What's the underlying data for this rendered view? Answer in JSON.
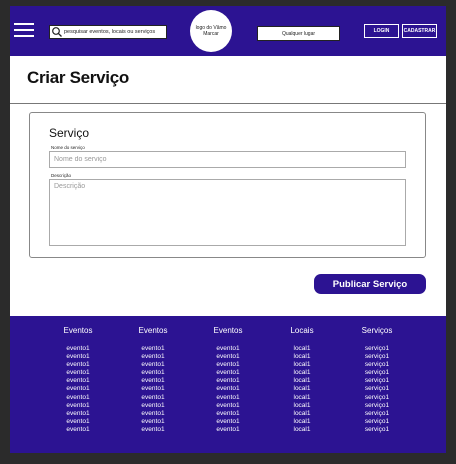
{
  "header": {
    "search_placeholder": "pesquisar eventos, locais ou serviços",
    "logo_text": "logo do Vâmo Marcar",
    "location_label": "Qualquer lugar",
    "login_label": "LOGIN",
    "cadastrar_label": "CADASTRAR"
  },
  "page": {
    "title": "Criar Serviço"
  },
  "form": {
    "section_title": "Serviço",
    "name_label": "Nome do serviço",
    "name_placeholder": "Nome do serviço",
    "description_label": "Descrição",
    "description_placeholder": "Descrição",
    "submit_label": "Publicar Serviço"
  },
  "footer": {
    "columns": [
      {
        "title": "Eventos",
        "items": [
          "evento1",
          "evento1",
          "evento1",
          "evento1",
          "evento1",
          "evento1",
          "evento1",
          "evento1",
          "evento1",
          "evento1",
          "evento1"
        ]
      },
      {
        "title": "Eventos",
        "items": [
          "evento1",
          "evento1",
          "evento1",
          "evento1",
          "evento1",
          "evento1",
          "evento1",
          "evento1",
          "evento1",
          "evento1",
          "evento1"
        ]
      },
      {
        "title": "Eventos",
        "items": [
          "evento1",
          "evento1",
          "evento1",
          "evento1",
          "evento1",
          "evento1",
          "evento1",
          "evento1",
          "evento1",
          "evento1",
          "evento1"
        ]
      },
      {
        "title": "Locais",
        "items": [
          "local1",
          "local1",
          "local1",
          "local1",
          "local1",
          "local1",
          "local1",
          "local1",
          "local1",
          "local1",
          "local1"
        ]
      },
      {
        "title": "Serviços",
        "items": [
          "serviço1",
          "serviço1",
          "serviço1",
          "serviço1",
          "serviço1",
          "serviço1",
          "serviço1",
          "serviço1",
          "serviço1",
          "serviço1",
          "serviço1"
        ]
      }
    ]
  },
  "colors": {
    "brand": "#2c1392",
    "background": "#ffffff"
  },
  "icons": [
    "menu-icon",
    "search-icon"
  ]
}
